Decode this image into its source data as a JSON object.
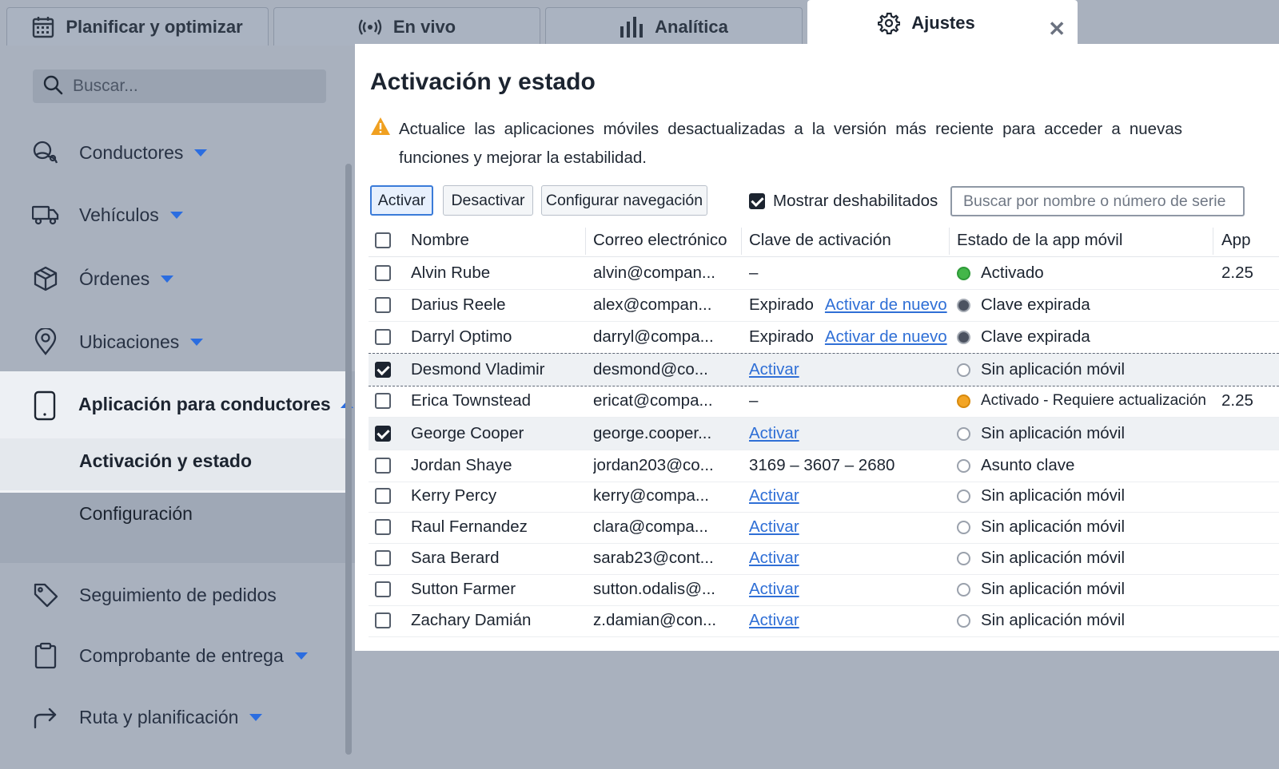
{
  "tabs": [
    {
      "label": "Planificar y optimizar",
      "icon": "calendar-icon"
    },
    {
      "label": "En vivo",
      "icon": "broadcast-icon"
    },
    {
      "label": "Analítica",
      "icon": "bar-chart-icon"
    },
    {
      "label": "Ajustes",
      "icon": "gear-icon",
      "active": true
    }
  ],
  "sidebar": {
    "search_placeholder": "Buscar...",
    "items": [
      {
        "label": "Conductores",
        "icon": "drivers-icon"
      },
      {
        "label": "Vehículos",
        "icon": "truck-icon"
      },
      {
        "label": "Órdenes",
        "icon": "package-icon"
      },
      {
        "label": "Ubicaciones",
        "icon": "map-pin-icon"
      },
      {
        "label": "Aplicación para conductores",
        "icon": "phone-icon",
        "expanded": true,
        "children": [
          "Activación y estado",
          "Configuración"
        ]
      },
      {
        "label": "Seguimiento de pedidos",
        "icon": "tag-icon"
      },
      {
        "label": "Comprobante de entrega",
        "icon": "clipboard-icon"
      },
      {
        "label": "Ruta y planificación",
        "icon": "route-icon"
      }
    ]
  },
  "main": {
    "title": "Activación y estado",
    "warning": "Actualice las aplicaciones móviles desactualizadas a la versión más reciente para acceder a nuevas funciones y mejorar la estabilidad.",
    "toolbar": {
      "activate": "Activar",
      "deactivate": "Desactivar",
      "configure_nav": "Configurar navegación",
      "show_disabled": "Mostrar deshabilitados",
      "show_disabled_checked": true,
      "search_placeholder": "Buscar por nombre o número de serie"
    },
    "columns": [
      "Nombre",
      "Correo electrónico",
      "Clave de activación",
      "Estado de la app móvil",
      "App"
    ],
    "rows": [
      {
        "name": "Alvin Rube",
        "email": "alvin@compan...",
        "key": "–",
        "status": "Activado",
        "dot": "green",
        "app": "2.25"
      },
      {
        "name": "Darius Reele",
        "email": "alex@compan...",
        "key": "Expirado",
        "key_link": "Activar de nuevo",
        "status": "Clave expirada",
        "dot": "grey",
        "app": ""
      },
      {
        "name": "Darryl Optimo",
        "email": "darryl@compa...",
        "key": "Expirado",
        "key_link": "Activar de nuevo",
        "status": "Clave expirada",
        "dot": "grey",
        "app": ""
      },
      {
        "name": "Desmond Vladimir",
        "email": "desmond@co...",
        "key_link": "Activar",
        "status": "Sin aplicación móvil",
        "dot": "empty",
        "app": "",
        "checked": true
      },
      {
        "name": "Erica Townstead",
        "email": "ericat@compa...",
        "key": "–",
        "status": "Activado - Requiere actualización",
        "dot": "orange",
        "app": "2.25"
      },
      {
        "name": "George Cooper",
        "email": "george.cooper...",
        "key_link": "Activar",
        "status": "Sin aplicación móvil",
        "dot": "empty",
        "app": "",
        "checked": true
      },
      {
        "name": "Jordan Shaye",
        "email": "jordan203@co...",
        "key": "3169 – 3607 – 2680",
        "status": "Asunto clave",
        "dot": "empty",
        "app": ""
      },
      {
        "name": "Kerry Percy",
        "email": "kerry@compa...",
        "key_link": "Activar",
        "status": "Sin aplicación móvil",
        "dot": "empty",
        "app": ""
      },
      {
        "name": "Raul Fernandez",
        "email": "clara@compa...",
        "key_link": "Activar",
        "status": "Sin aplicación móvil",
        "dot": "empty",
        "app": ""
      },
      {
        "name": "Sara Berard",
        "email": "sarab23@cont...",
        "key_link": "Activar",
        "status": "Sin aplicación móvil",
        "dot": "empty",
        "app": ""
      },
      {
        "name": "Sutton Farmer",
        "email": "sutton.odalis@...",
        "key_link": "Activar",
        "status": "Sin aplicación móvil",
        "dot": "empty",
        "app": ""
      },
      {
        "name": "Zachary Damián",
        "email": "z.damian@con...",
        "key_link": "Activar",
        "status": "Sin aplicación móvil",
        "dot": "empty",
        "app": ""
      }
    ]
  },
  "colors": {
    "accent": "#2b6de0",
    "link": "#2f6fd6",
    "warning": "#f0a020",
    "status_green": "#43b649",
    "status_orange": "#f3a525"
  }
}
